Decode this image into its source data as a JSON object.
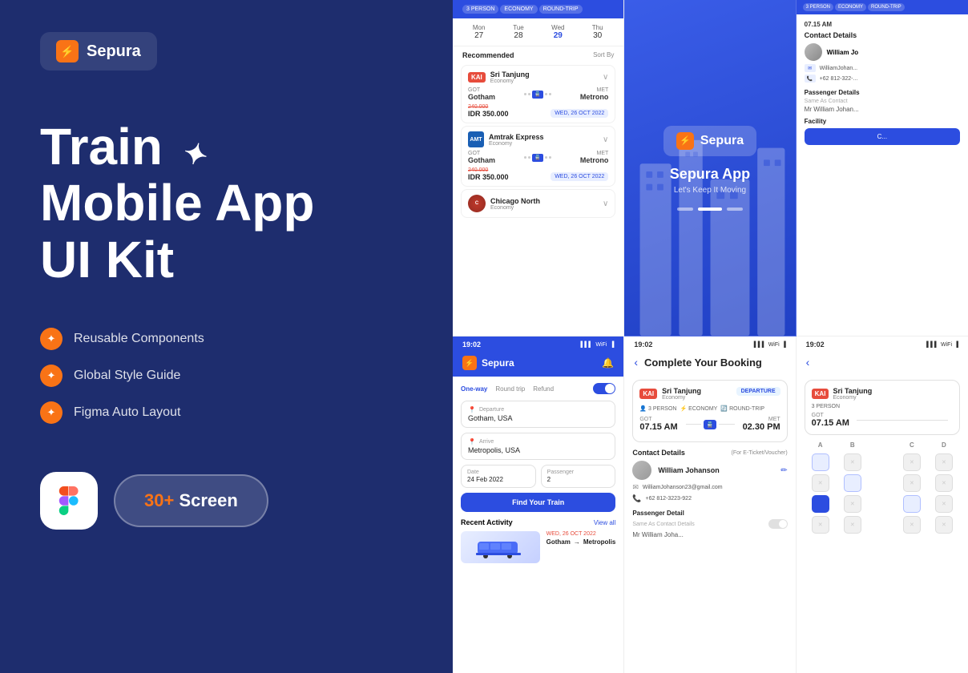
{
  "brand": {
    "name": "Sepura",
    "icon": "⚡"
  },
  "headline": {
    "line1": "Train",
    "line2": "Mobile App",
    "line3": "UI Kit"
  },
  "features": [
    {
      "text": "Reusable Components"
    },
    {
      "text": "Global Style Guide"
    },
    {
      "text": "Figma Auto Layout"
    }
  ],
  "screens_count": "30+",
  "screens_label": " Screen",
  "mockup1": {
    "tags": [
      "3 PERSON",
      "ECONOMY",
      "ROUND-TRIP"
    ],
    "days": [
      {
        "name": "Mon",
        "num": "27"
      },
      {
        "name": "Tue",
        "num": "28"
      },
      {
        "name": "Wed",
        "num": "29",
        "active": true
      },
      {
        "name": "Thu",
        "num": "30"
      }
    ],
    "section_title": "Recommended",
    "sort_label": "Sort By",
    "trains": [
      {
        "logo": "KAI",
        "name": "Sri Tanjung",
        "class": "Economy",
        "from": "GOT",
        "from_name": "Gotham",
        "to": "MET",
        "to_name": "Metrono",
        "old_price": "240.000",
        "price": "IDR 350.000",
        "date": "WED, 26 OCT 2022"
      },
      {
        "logo": "AMT",
        "name": "Amtrak Express",
        "class": "Economy",
        "from": "GOT",
        "from_name": "Gotham",
        "to": "MET",
        "to_name": "Metrono",
        "old_price": "240.000",
        "price": "IDR 350.000",
        "date": "WED, 26 OCT 2022"
      },
      {
        "logo": "CHI",
        "name": "Chicago North",
        "class": "Economy"
      }
    ]
  },
  "mockup2": {
    "app_name": "Sepura App",
    "tagline": "Let's Keep It Moving"
  },
  "mockup3": {
    "status": "07.15 AM",
    "contact_section": "Contact Details",
    "contact_name": "William Jo",
    "email": "WilliamJohan...",
    "phone": "+62 812-322-...",
    "passenger_section": "Passenger Details",
    "same_as": "Same As Contact",
    "passenger_name": "Mr William Johan...",
    "facility_section": "Facility"
  },
  "mockup4": {
    "time": "19:02",
    "app_name": "Sepura",
    "tabs": [
      "One-way",
      "Round trip",
      "Refund"
    ],
    "departure_label": "Departure",
    "departure_value": "Gotham, USA",
    "arrive_label": "Arrive",
    "arrive_value": "Metropolis, USA",
    "date_label": "Date",
    "date_value": "24 Feb 2022",
    "passenger_label": "Passenger",
    "passenger_value": "2",
    "find_btn": "Find Your Train",
    "recent_title": "Recent Activity",
    "view_all": "View all",
    "recent_date": "WED, 26 OCT 2022",
    "recent_route_from": "Gotham",
    "recent_route_to": "Metropolis"
  },
  "mockup5": {
    "time": "19:02",
    "title": "Complete Your Booking",
    "train_name": "Sri Tanjung",
    "train_class": "Economy",
    "badge": "DEPARTURE",
    "tags": [
      "3 PERSON",
      "ECONOMY",
      "ROUND-TRIP"
    ],
    "got_label": "GOT",
    "got_time": "07.15 AM",
    "met_label": "MET",
    "met_time": "02.30 PM",
    "contact_section": "Contact Details",
    "for_label": "(For E-Ticket/Voucher)",
    "contact_name": "William Johanson",
    "email": "WilliamJohanson23@gmail.com",
    "phone": "+62 812-3223-922",
    "passenger_section": "Passenger Detail",
    "same_text": "Same As Contact Details",
    "pass_name": "Mr William Joha..."
  },
  "mockup6": {
    "time": "19:02",
    "train_name": "Sri Tanjung",
    "train_class": "Economy",
    "got_label": "GOT",
    "got_time": "07.15 AM",
    "tags_label": "3 PERSON",
    "seat_cols": [
      "A",
      "B",
      "",
      "C",
      "D"
    ],
    "seat_rows": [
      [
        "available",
        "taken",
        "",
        "taken",
        "taken"
      ],
      [
        "taken",
        "available",
        "",
        "taken",
        "taken"
      ],
      [
        "taken",
        "taken",
        "",
        "available",
        "taken"
      ],
      [
        "taken",
        "taken",
        "",
        "taken",
        "taken"
      ]
    ]
  }
}
